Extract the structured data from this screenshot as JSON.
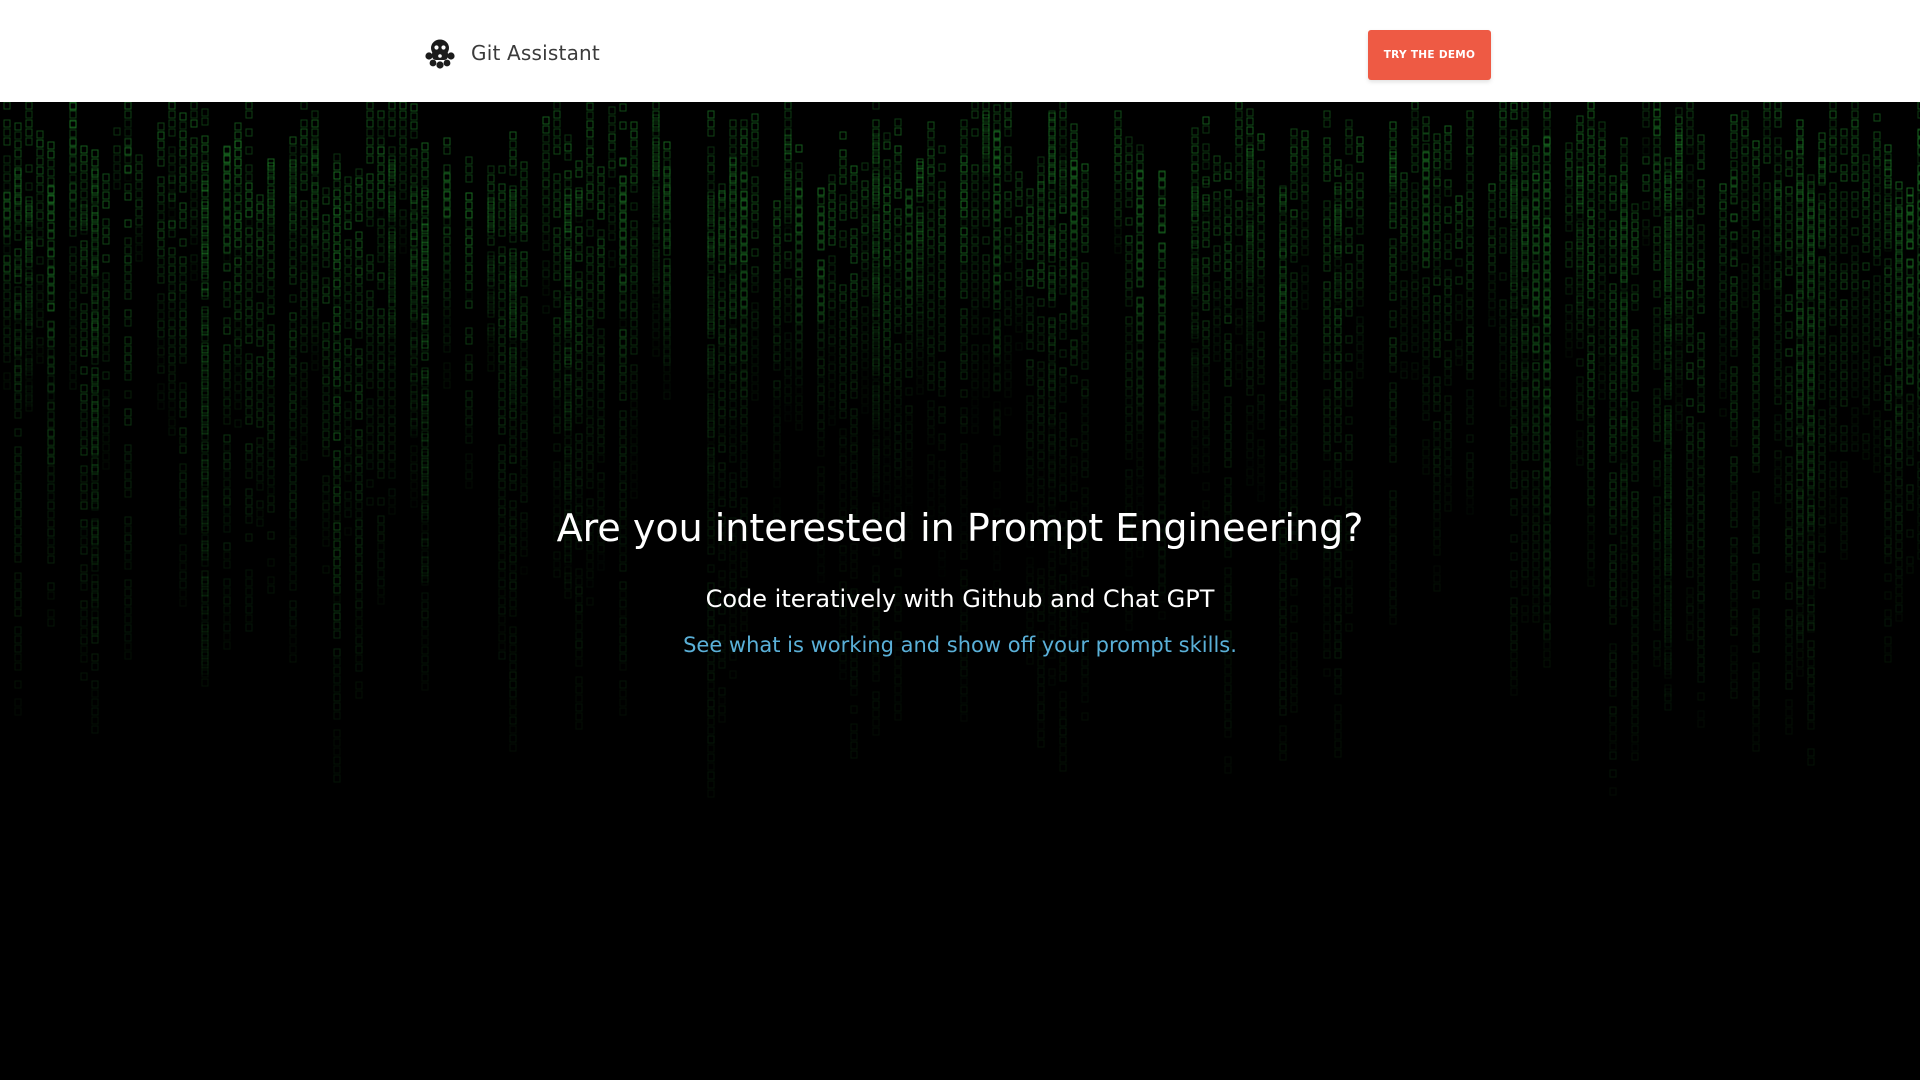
{
  "header": {
    "brand_name": "Git Assistant",
    "brand_icon": "octopus-logo-icon",
    "cta_label": "TRY THE DEMO"
  },
  "hero": {
    "title": "Are you interested in Prompt Engineering?",
    "subtitle": "Code iteratively with Github and Chat GPT",
    "link_text": "See what is working and show off your prompt skills.",
    "background": "matrix-code-rain"
  },
  "colors": {
    "header_bg": "#ffffff",
    "cta_bg": "#ee5a44",
    "hero_bg": "#000000",
    "rain_green": "#1f8a2a",
    "link_blue": "#5ab0d8",
    "brand_text": "#3b3b3b"
  }
}
